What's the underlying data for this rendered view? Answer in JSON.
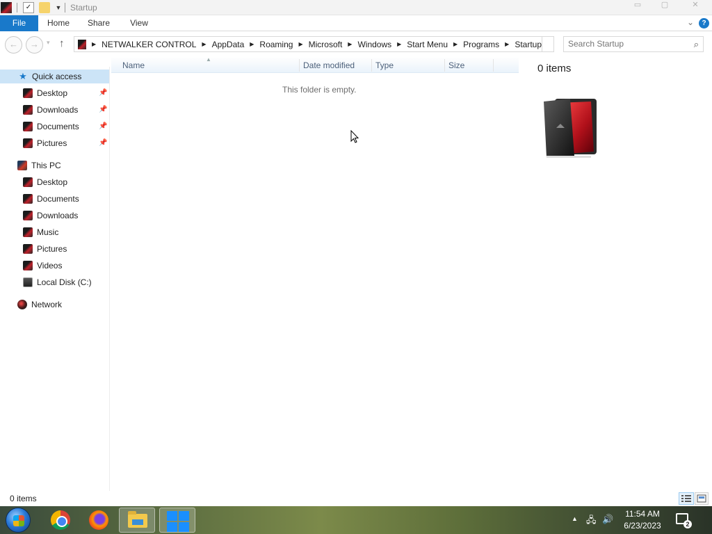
{
  "window": {
    "title": "Startup",
    "controls": [
      "minimize",
      "maximize",
      "close"
    ]
  },
  "ribbon": {
    "tabs": [
      {
        "label": "File",
        "active": true
      },
      {
        "label": "Home"
      },
      {
        "label": "Share"
      },
      {
        "label": "View"
      }
    ],
    "help_label": "?"
  },
  "address": {
    "breadcrumbs": [
      "NETWALKER CONTROL",
      "AppData",
      "Roaming",
      "Microsoft",
      "Windows",
      "Start Menu",
      "Programs",
      "Startup"
    ]
  },
  "search": {
    "placeholder": "Search Startup"
  },
  "nav": {
    "quick_access": {
      "label": "Quick access",
      "items": [
        {
          "label": "Desktop",
          "pinned": true
        },
        {
          "label": "Downloads",
          "pinned": true
        },
        {
          "label": "Documents",
          "pinned": true
        },
        {
          "label": "Pictures",
          "pinned": true
        }
      ]
    },
    "this_pc": {
      "label": "This PC",
      "items": [
        {
          "label": "Desktop"
        },
        {
          "label": "Documents"
        },
        {
          "label": "Downloads"
        },
        {
          "label": "Music"
        },
        {
          "label": "Pictures"
        },
        {
          "label": "Videos"
        },
        {
          "label": "Local Disk (C:)"
        }
      ]
    },
    "network": {
      "label": "Network"
    }
  },
  "content": {
    "columns": [
      "Name",
      "Date modified",
      "Type",
      "Size"
    ],
    "empty_message": "This folder is empty."
  },
  "details_pane": {
    "items_count": "0 items"
  },
  "statusbar": {
    "text": "0 items"
  },
  "taskbar": {
    "apps": [
      "start-button",
      "chrome",
      "firefox",
      "file-explorer",
      "windows-app"
    ],
    "clock": {
      "time": "11:54 AM",
      "date": "6/23/2023"
    },
    "notification_count": "2"
  },
  "colors": {
    "accent": "#1979ca",
    "selected_bg": "#cce4f7"
  }
}
